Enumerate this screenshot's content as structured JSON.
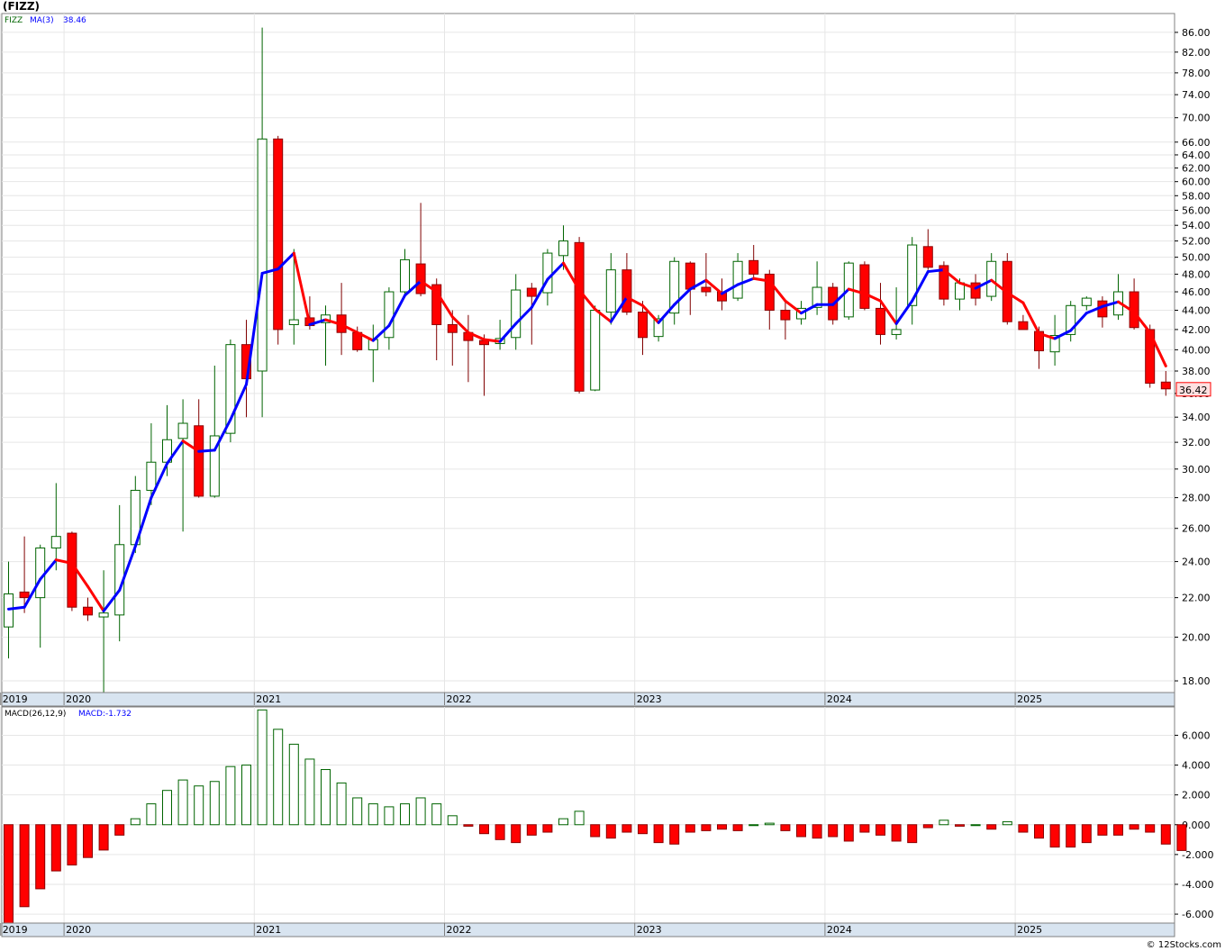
{
  "page": {
    "title": "(FIZZ)",
    "credit": "© 12Stocks.com"
  },
  "chart_data": [
    {
      "type": "candlestick",
      "scale": "log",
      "symbol": "FIZZ",
      "legend_label": "MA(3)",
      "legend_value": "38.46",
      "last_price_label": "36.42",
      "ylim": [
        17.5,
        90
      ],
      "yticks": [
        18,
        20,
        22,
        24,
        26,
        28,
        30,
        32,
        34,
        36,
        38,
        40,
        42,
        44,
        46,
        48,
        50,
        52,
        54,
        56,
        58,
        60,
        62,
        64,
        66,
        70,
        74,
        78,
        82,
        86
      ],
      "ytick_labels": [
        "18.00",
        "20.00",
        "22.00",
        "24.00",
        "26.00",
        "28.00",
        "30.00",
        "32.00",
        "34.00",
        "36.00",
        "38.00",
        "40.00",
        "42.00",
        "44.00",
        "46.00",
        "48.00",
        "50.00",
        "52.00",
        "54.00",
        "56.00",
        "58.00",
        "60.00",
        "62.00",
        "64.00",
        "66.00",
        "70.00",
        "74.00",
        "78.00",
        "82.00",
        "86.00"
      ],
      "xlim": [
        0,
        77
      ],
      "year_ticks": [
        {
          "label": "2019",
          "index": 0
        },
        {
          "label": "2020",
          "index": 4
        },
        {
          "label": "2021",
          "index": 16
        },
        {
          "label": "2022",
          "index": 28
        },
        {
          "label": "2023",
          "index": 40
        },
        {
          "label": "2024",
          "index": 52
        },
        {
          "label": "2025",
          "index": 64
        }
      ],
      "candles": [
        {
          "o": 20.5,
          "h": 24.0,
          "l": 19.0,
          "c": 22.2
        },
        {
          "o": 22.3,
          "h": 25.5,
          "l": 21.2,
          "c": 22.0
        },
        {
          "o": 22.0,
          "h": 25.0,
          "l": 19.5,
          "c": 24.8
        },
        {
          "o": 24.8,
          "h": 29.0,
          "l": 23.5,
          "c": 25.5
        },
        {
          "o": 25.7,
          "h": 25.8,
          "l": 21.3,
          "c": 21.5
        },
        {
          "o": 21.5,
          "h": 22.0,
          "l": 20.8,
          "c": 21.1
        },
        {
          "o": 21.0,
          "h": 23.5,
          "l": 17.5,
          "c": 21.2
        },
        {
          "o": 21.1,
          "h": 27.5,
          "l": 19.8,
          "c": 25.0
        },
        {
          "o": 25.0,
          "h": 29.5,
          "l": 24.5,
          "c": 28.5
        },
        {
          "o": 28.5,
          "h": 33.5,
          "l": 27.5,
          "c": 30.5
        },
        {
          "o": 30.5,
          "h": 35.0,
          "l": 29.5,
          "c": 32.2
        },
        {
          "o": 32.3,
          "h": 35.5,
          "l": 25.8,
          "c": 33.5
        },
        {
          "o": 33.3,
          "h": 35.5,
          "l": 28.0,
          "c": 28.1
        },
        {
          "o": 28.1,
          "h": 38.5,
          "l": 28.0,
          "c": 32.5
        },
        {
          "o": 32.7,
          "h": 41.0,
          "l": 32.0,
          "c": 40.5
        },
        {
          "o": 40.5,
          "h": 43.0,
          "l": 34.0,
          "c": 37.3
        },
        {
          "o": 38.0,
          "h": 87.0,
          "l": 34.0,
          "c": 66.5
        },
        {
          "o": 66.5,
          "h": 67.0,
          "l": 40.5,
          "c": 42.0
        },
        {
          "o": 42.5,
          "h": 51.0,
          "l": 40.5,
          "c": 43.0
        },
        {
          "o": 43.2,
          "h": 45.5,
          "l": 42.0,
          "c": 42.4
        },
        {
          "o": 42.7,
          "h": 44.5,
          "l": 38.5,
          "c": 43.5
        },
        {
          "o": 43.5,
          "h": 47.0,
          "l": 39.5,
          "c": 41.7
        },
        {
          "o": 41.7,
          "h": 42.3,
          "l": 39.8,
          "c": 40.0
        },
        {
          "o": 40.0,
          "h": 42.5,
          "l": 37.0,
          "c": 41.0
        },
        {
          "o": 41.2,
          "h": 46.5,
          "l": 40.0,
          "c": 46.0
        },
        {
          "o": 46.0,
          "h": 51.0,
          "l": 45.5,
          "c": 49.7
        },
        {
          "o": 49.2,
          "h": 57.0,
          "l": 45.5,
          "c": 45.8
        },
        {
          "o": 46.8,
          "h": 47.5,
          "l": 39.0,
          "c": 42.5
        },
        {
          "o": 42.5,
          "h": 44.0,
          "l": 38.5,
          "c": 41.7
        },
        {
          "o": 41.7,
          "h": 43.5,
          "l": 37.0,
          "c": 40.9
        },
        {
          "o": 40.9,
          "h": 41.5,
          "l": 35.8,
          "c": 40.5
        },
        {
          "o": 40.6,
          "h": 43.0,
          "l": 40.0,
          "c": 41.1
        },
        {
          "o": 41.2,
          "h": 48.0,
          "l": 40.0,
          "c": 46.2
        },
        {
          "o": 46.4,
          "h": 47.0,
          "l": 40.5,
          "c": 45.5
        },
        {
          "o": 45.9,
          "h": 51.0,
          "l": 44.5,
          "c": 50.5
        },
        {
          "o": 50.2,
          "h": 54.0,
          "l": 48.5,
          "c": 52.0
        },
        {
          "o": 51.8,
          "h": 52.5,
          "l": 36.0,
          "c": 36.2
        },
        {
          "o": 36.3,
          "h": 44.5,
          "l": 36.2,
          "c": 44.0
        },
        {
          "o": 43.8,
          "h": 50.5,
          "l": 42.5,
          "c": 48.5
        },
        {
          "o": 48.5,
          "h": 50.5,
          "l": 43.5,
          "c": 43.8
        },
        {
          "o": 43.8,
          "h": 45.0,
          "l": 39.5,
          "c": 41.2
        },
        {
          "o": 41.3,
          "h": 43.5,
          "l": 40.8,
          "c": 43.1
        },
        {
          "o": 43.7,
          "h": 50.0,
          "l": 42.5,
          "c": 49.5
        },
        {
          "o": 49.3,
          "h": 49.5,
          "l": 43.5,
          "c": 46.3
        },
        {
          "o": 46.5,
          "h": 50.5,
          "l": 45.5,
          "c": 46.0
        },
        {
          "o": 46.0,
          "h": 47.5,
          "l": 44.0,
          "c": 45.0
        },
        {
          "o": 45.3,
          "h": 50.5,
          "l": 45.0,
          "c": 49.5
        },
        {
          "o": 49.6,
          "h": 51.5,
          "l": 47.5,
          "c": 48.0
        },
        {
          "o": 48.0,
          "h": 48.5,
          "l": 42.0,
          "c": 44.0
        },
        {
          "o": 44.0,
          "h": 45.0,
          "l": 41.0,
          "c": 43.0
        },
        {
          "o": 43.1,
          "h": 45.0,
          "l": 42.5,
          "c": 44.2
        },
        {
          "o": 44.3,
          "h": 49.5,
          "l": 43.5,
          "c": 46.5
        },
        {
          "o": 46.5,
          "h": 47.0,
          "l": 42.5,
          "c": 43.0
        },
        {
          "o": 43.3,
          "h": 49.5,
          "l": 43.0,
          "c": 49.3
        },
        {
          "o": 49.1,
          "h": 49.5,
          "l": 44.0,
          "c": 44.2
        },
        {
          "o": 44.2,
          "h": 47.0,
          "l": 40.5,
          "c": 41.5
        },
        {
          "o": 41.5,
          "h": 46.5,
          "l": 41.0,
          "c": 42.0
        },
        {
          "o": 44.5,
          "h": 52.5,
          "l": 42.5,
          "c": 51.5
        },
        {
          "o": 51.3,
          "h": 53.5,
          "l": 48.5,
          "c": 48.8
        },
        {
          "o": 49.0,
          "h": 49.5,
          "l": 44.5,
          "c": 45.2
        },
        {
          "o": 45.2,
          "h": 47.5,
          "l": 44.0,
          "c": 47.0
        },
        {
          "o": 47.0,
          "h": 48.0,
          "l": 44.5,
          "c": 45.3
        },
        {
          "o": 45.5,
          "h": 50.5,
          "l": 45.0,
          "c": 49.5
        },
        {
          "o": 49.5,
          "h": 50.5,
          "l": 42.5,
          "c": 42.8
        },
        {
          "o": 42.8,
          "h": 43.5,
          "l": 42.0,
          "c": 42.0
        },
        {
          "o": 41.8,
          "h": 42.3,
          "l": 38.2,
          "c": 39.9
        },
        {
          "o": 39.8,
          "h": 43.5,
          "l": 38.5,
          "c": 41.4
        },
        {
          "o": 41.5,
          "h": 45.0,
          "l": 40.8,
          "c": 44.5
        },
        {
          "o": 44.5,
          "h": 45.5,
          "l": 44.0,
          "c": 45.3
        },
        {
          "o": 45.0,
          "h": 45.5,
          "l": 42.2,
          "c": 43.3
        },
        {
          "o": 43.5,
          "h": 48.0,
          "l": 43.0,
          "c": 46.0
        },
        {
          "o": 46.0,
          "h": 47.5,
          "l": 42.0,
          "c": 42.2
        },
        {
          "o": 42.0,
          "h": 42.5,
          "l": 36.5,
          "c": 36.9
        },
        {
          "o": 37.0,
          "h": 38.0,
          "l": 35.8,
          "c": 36.4
        }
      ],
      "ma": [
        21.4,
        21.5,
        23.0,
        24.1,
        23.9,
        22.6,
        21.3,
        22.4,
        24.9,
        28.0,
        30.4,
        32.1,
        31.3,
        31.4,
        33.8,
        36.8,
        48.1,
        48.6,
        50.5,
        42.5,
        43.0,
        42.5,
        41.7,
        40.9,
        42.4,
        45.6,
        47.2,
        46.0,
        43.3,
        41.7,
        41.0,
        40.8,
        42.6,
        44.3,
        47.4,
        49.3,
        46.2,
        44.1,
        42.8,
        45.4,
        44.5,
        42.7,
        44.6,
        46.3,
        47.3,
        45.8,
        46.8,
        47.5,
        47.2,
        45.0,
        43.7,
        44.6,
        44.6,
        46.3,
        45.8,
        45.0,
        42.6,
        45.0,
        48.3,
        48.5,
        47.0,
        46.4,
        47.3,
        45.9,
        44.8,
        41.6,
        41.1,
        41.9,
        43.7,
        44.4,
        44.9,
        43.8,
        41.7,
        38.46
      ],
      "colors": {
        "up": "#ffffff",
        "up_stroke": "#006400",
        "down": "#ff0000",
        "down_stroke": "#8b0000",
        "ma_up": "#0000ff",
        "ma_down": "#ff0000"
      }
    },
    {
      "type": "bar",
      "indicator": "MACD",
      "legend_label": "MACD(26,12,9)",
      "legend_value": "MACD:-1.732",
      "ylim": [
        -6.6,
        7.9
      ],
      "yticks": [
        -6,
        -4,
        -2,
        0,
        2,
        4,
        6
      ],
      "ytick_labels": [
        "-6.000",
        "-4.000",
        "-2.000",
        "0.000",
        "2.000",
        "4.000",
        "6.000"
      ],
      "year_ticks": [
        {
          "label": "2019",
          "index": 0
        },
        {
          "label": "2020",
          "index": 4
        },
        {
          "label": "2021",
          "index": 16
        },
        {
          "label": "2022",
          "index": 28
        },
        {
          "label": "2023",
          "index": 40
        },
        {
          "label": "2024",
          "index": 52
        },
        {
          "label": "2025",
          "index": 64
        }
      ],
      "values": [
        -6.8,
        -5.5,
        -4.3,
        -3.1,
        -2.7,
        -2.2,
        -1.7,
        -0.7,
        0.4,
        1.4,
        2.3,
        3.0,
        2.6,
        2.9,
        3.9,
        4.0,
        7.7,
        6.4,
        5.4,
        4.4,
        3.7,
        2.8,
        1.8,
        1.4,
        1.2,
        1.4,
        1.8,
        1.4,
        0.6,
        -0.1,
        -0.6,
        -1.0,
        -1.2,
        -0.7,
        -0.5,
        0.4,
        0.9,
        -0.8,
        -0.9,
        -0.5,
        -0.6,
        -1.2,
        -1.3,
        -0.5,
        -0.4,
        -0.3,
        -0.4,
        0.0,
        0.1,
        -0.4,
        -0.8,
        -0.9,
        -0.8,
        -1.1,
        -0.5,
        -0.7,
        -1.1,
        -1.2,
        -0.2,
        0.3,
        -0.1,
        0.0,
        -0.3,
        0.2,
        -0.5,
        -0.9,
        -1.5,
        -1.5,
        -1.2,
        -0.7,
        -0.7,
        -0.3,
        -0.5,
        -1.3,
        -1.73
      ],
      "colors": {
        "pos_stroke": "#006400",
        "neg": "#ff0000",
        "neg_stroke": "#8b0000"
      }
    }
  ]
}
